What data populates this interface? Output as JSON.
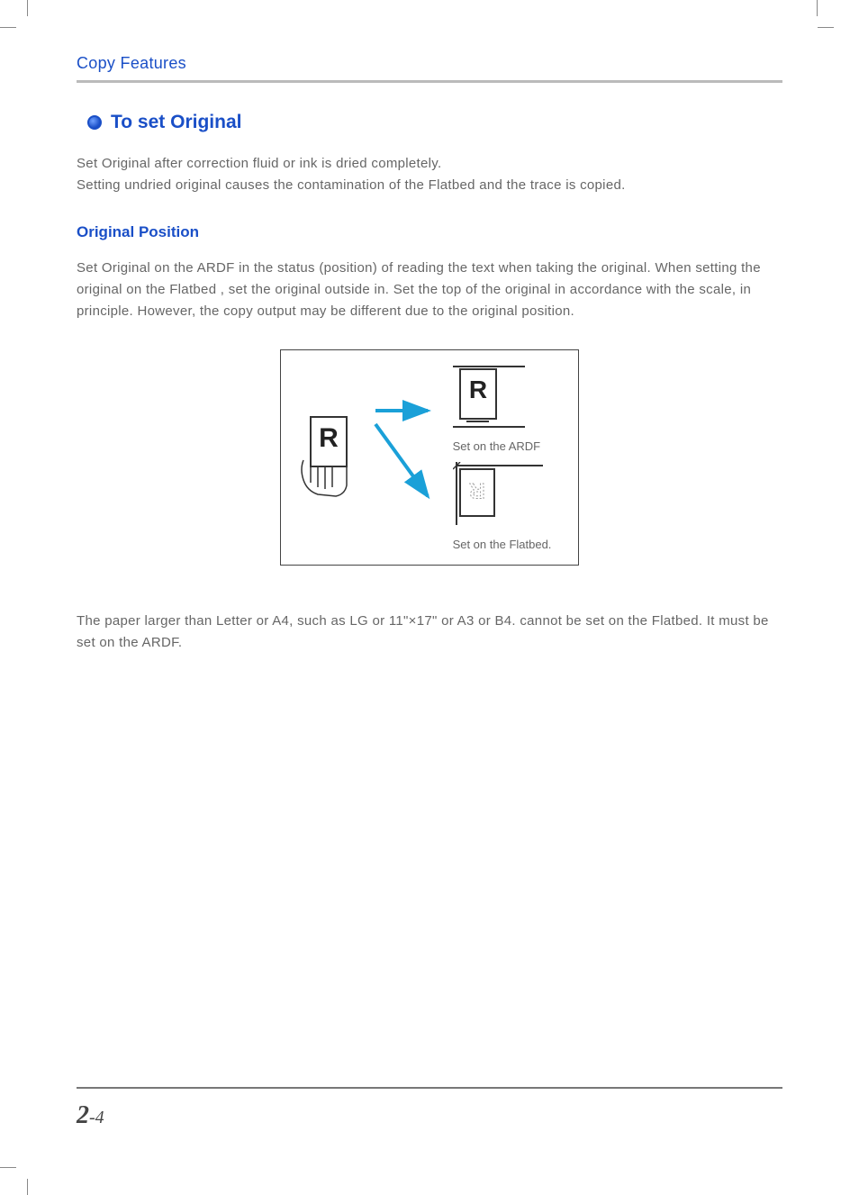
{
  "chapter": "Copy Features",
  "section": {
    "title": "To set Original",
    "intro": "Set Original after correction fluid or ink is dried completely.\nSetting undried original causes the contamination of the Flatbed  and the trace is copied."
  },
  "subsection": {
    "title": "Original Position",
    "body": "Set Original on the ARDF in the status (position) of reading the text when taking the original. When setting the original on the Flatbed , set the original outside in. Set the top of the original in accordance with the scale, in principle. However, the copy output may be different due to the original position.",
    "note": "The paper larger than Letter or A4, such as LG or 11\"×17\" or A3 or B4. cannot be set on the Flatbed. It must be set on the ARDF."
  },
  "diagram": {
    "ardf_label": "Set on the ARDF",
    "flatbed_label": "Set on the Flatbed.",
    "letter": "R"
  },
  "page": {
    "chapter_num": "2",
    "sep": "-",
    "page_num": "4"
  }
}
